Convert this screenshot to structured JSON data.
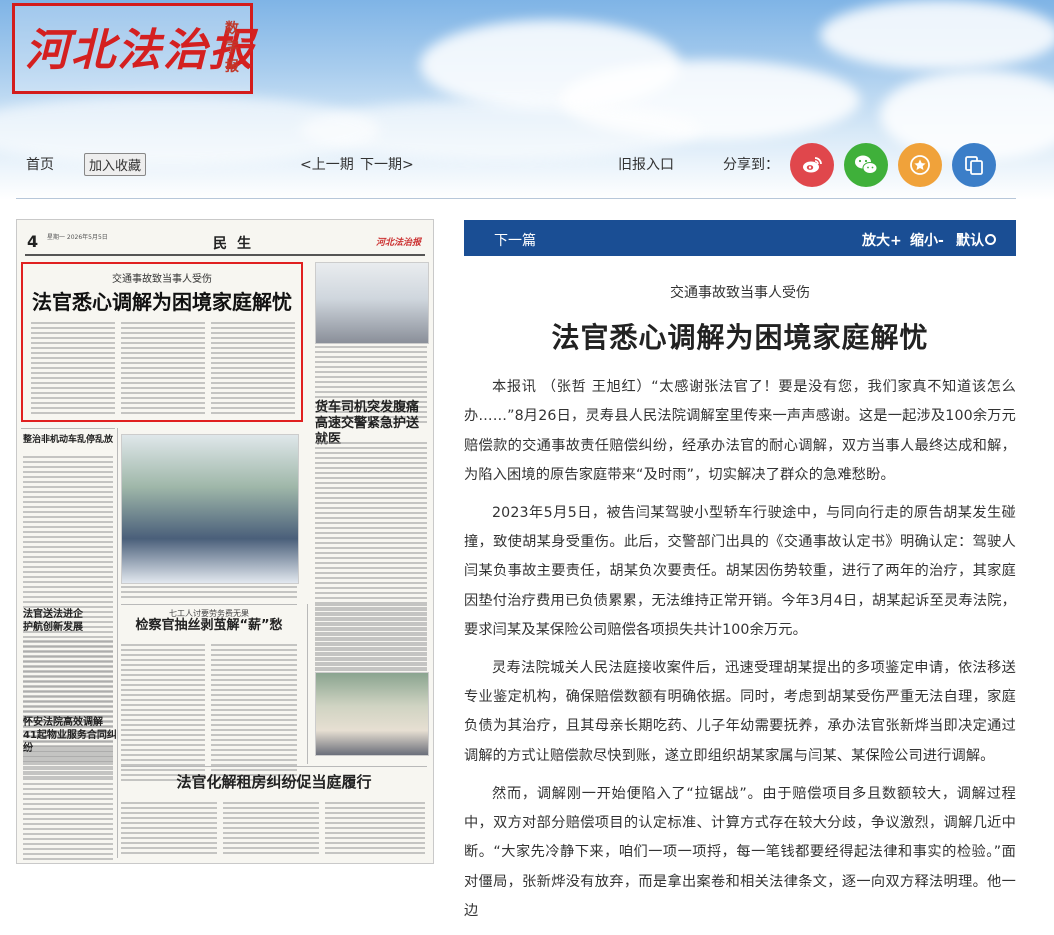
{
  "brand": {
    "name": "河北法治报",
    "edition_label": "数字报"
  },
  "nav": {
    "home": "首页",
    "favorite": "加入收藏",
    "prev_issue": "<上一期",
    "next_issue": "下一期>",
    "archive": "旧报入口",
    "share_label": "分享到："
  },
  "share": [
    {
      "name": "weibo-icon",
      "color": "#e0474c"
    },
    {
      "name": "wechat-icon",
      "color": "#3fb03a"
    },
    {
      "name": "favorite-star-icon",
      "color": "#f0a23a"
    },
    {
      "name": "copy-link-icon",
      "color": "#3b7ec8"
    }
  ],
  "page_preview": {
    "page_number": "4",
    "date_line": "星期一 2026年5月5日",
    "section": "民生",
    "brand": "河北法治报",
    "highlight_kicker": "交通事故致当事人受伤",
    "highlight_title": "法官悉心调解为困境家庭解忧",
    "headlines": {
      "h1": "货车司机突发腹痛",
      "h1b": "高速交警紧急护送就医",
      "h2": "检察官抽丝剥茧解“薪”愁",
      "h2_kicker": "七工人讨要劳务费无果",
      "h3": "法官化解租房纠纷促当庭履行",
      "h4": "整治非机动车乱停乱放",
      "h5": "法官送法进企",
      "h5b": "护航创新发展",
      "h6": "怀安法院高效调解",
      "h6b": "41起物业服务合同纠纷"
    }
  },
  "article": {
    "next_label": "下一篇",
    "zoom_in": "放大+",
    "zoom_out": "缩小-",
    "reset": "默认",
    "kicker": "交通事故致当事人受伤",
    "title": "法官悉心调解为困境家庭解忧",
    "paragraphs": [
      "本报讯 （张哲 王旭红）“太感谢张法官了！要是没有您，我们家真不知道该怎么办……”8月26日，灵寿县人民法院调解室里传来一声声感谢。这是一起涉及100余万元赔偿款的交通事故责任赔偿纠纷，经承办法官的耐心调解，双方当事人最终达成和解，为陷入困境的原告家庭带来“及时雨”，切实解决了群众的急难愁盼。",
      "2023年5月5日，被告闫某驾驶小型轿车行驶途中，与同向行走的原告胡某发生碰撞，致使胡某身受重伤。此后，交警部门出具的《交通事故认定书》明确认定：驾驶人闫某负事故主要责任，胡某负次要责任。胡某因伤势较重，进行了两年的治疗，其家庭因垫付治疗费用已负债累累，无法维持正常开销。今年3月4日，胡某起诉至灵寿法院，要求闫某及某保险公司赔偿各项损失共计100余万元。",
      "灵寿法院城关人民法庭接收案件后，迅速受理胡某提出的多项鉴定申请，依法移送专业鉴定机构，确保赔偿数额有明确依据。同时，考虑到胡某受伤严重无法自理，家庭负债为其治疗，且其母亲长期吃药、儿子年幼需要抚养，承办法官张新烨当即决定通过调解的方式让赔偿款尽快到账，遂立即组织胡某家属与闫某、某保险公司进行调解。",
      "然而，调解刚一开始便陷入了“拉锯战”。由于赔偿项目多且数额较大，调解过程中，双方对部分赔偿项目的认定标准、计算方式存在较大分歧，争议激烈，调解几近中断。“大家先冷静下来，咱们一项一项捋，每一笔钱都要经得起法律和事实的检验。”面对僵局，张新烨没有放弃，而是拿出案卷和相关法律条文，逐一向双方释法明理。他一边"
    ]
  }
}
